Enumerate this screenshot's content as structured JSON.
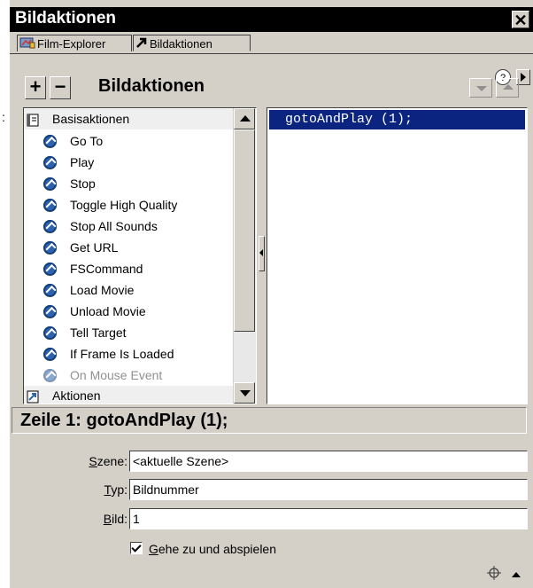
{
  "window": {
    "title": "Bildaktionen",
    "close_glyph": "✕"
  },
  "tabs": [
    {
      "label": "Film-Explorer",
      "icon": "film-explorer-icon"
    },
    {
      "label": "Bildaktionen",
      "icon": "arrow-icon"
    }
  ],
  "help_glyph": "?",
  "toolbar": {
    "plus": "+",
    "minus": "−",
    "title": "Bildaktionen"
  },
  "toolbox": {
    "categories": [
      {
        "label": "Basisaktionen",
        "icon": "book-icon"
      },
      {
        "label": "Aktionen",
        "icon": "book-icon"
      }
    ],
    "items": [
      {
        "label": "Go To"
      },
      {
        "label": "Play"
      },
      {
        "label": "Stop"
      },
      {
        "label": "Toggle High Quality"
      },
      {
        "label": "Stop All Sounds"
      },
      {
        "label": "Get URL"
      },
      {
        "label": "FSCommand"
      },
      {
        "label": "Load Movie"
      },
      {
        "label": "Unload Movie"
      },
      {
        "label": "Tell Target"
      },
      {
        "label": "If Frame Is Loaded"
      },
      {
        "label": "On Mouse Event"
      }
    ]
  },
  "code": {
    "lines": [
      "gotoAndPlay (1);"
    ]
  },
  "status": "Zeile 1: gotoAndPlay (1);",
  "params": {
    "scene_label_u": "S",
    "scene_label_rest": "zene:",
    "scene_value": "<aktuelle Szene>",
    "type_label_u": "T",
    "type_label_rest": "yp:",
    "type_value": "Bildnummer",
    "frame_label_u": "B",
    "frame_label_rest": "ild:",
    "frame_value": "1",
    "checkbox_label_u": "G",
    "checkbox_label_rest": "ehe zu und abspielen",
    "checkbox_checked": true
  },
  "colors": {
    "panel": "#d4d0c8",
    "selection": "#0a2480",
    "titlebar": "#000000"
  }
}
